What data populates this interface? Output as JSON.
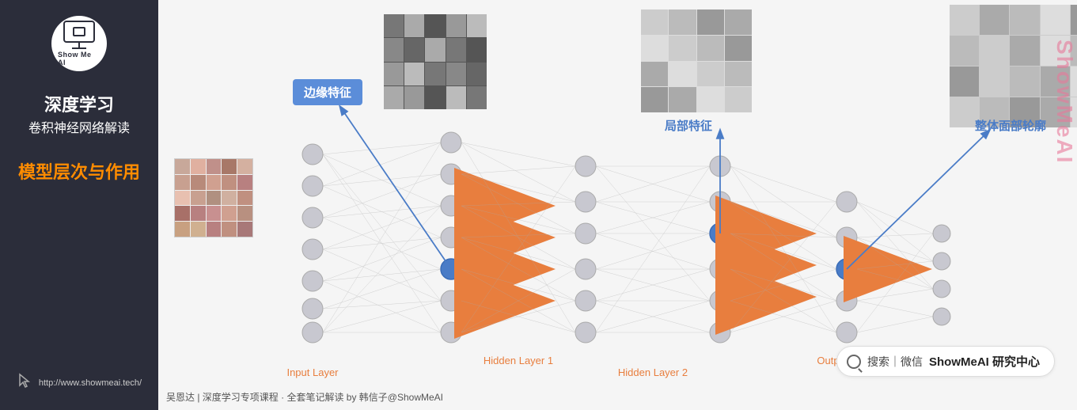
{
  "sidebar": {
    "logo_text": "Show Me AI",
    "title_main": "深度学习",
    "title_sub": "卷积神经网络解读",
    "highlight": "模型层次与作用",
    "url": "http://www.showmeai.tech/"
  },
  "diagram": {
    "label_edge": "边缘特征",
    "label_local": "局部特征",
    "label_face": "整体面部轮廓",
    "layer_input": "Input Layer",
    "layer_hidden1": "Hidden Layer 1",
    "layer_hidden2": "Hidden Layer 2",
    "layer_output": "Output Layer",
    "footer_caption": "吴恩达 | 深度学习专项课程 · 全套笔记解读  by 韩信子@ShowMeAI"
  },
  "search": {
    "icon": "search-icon",
    "text": "搜索｜微信",
    "brand": "ShowMeAI 研究中心"
  },
  "watermark": {
    "text": "ShowMeAI"
  }
}
